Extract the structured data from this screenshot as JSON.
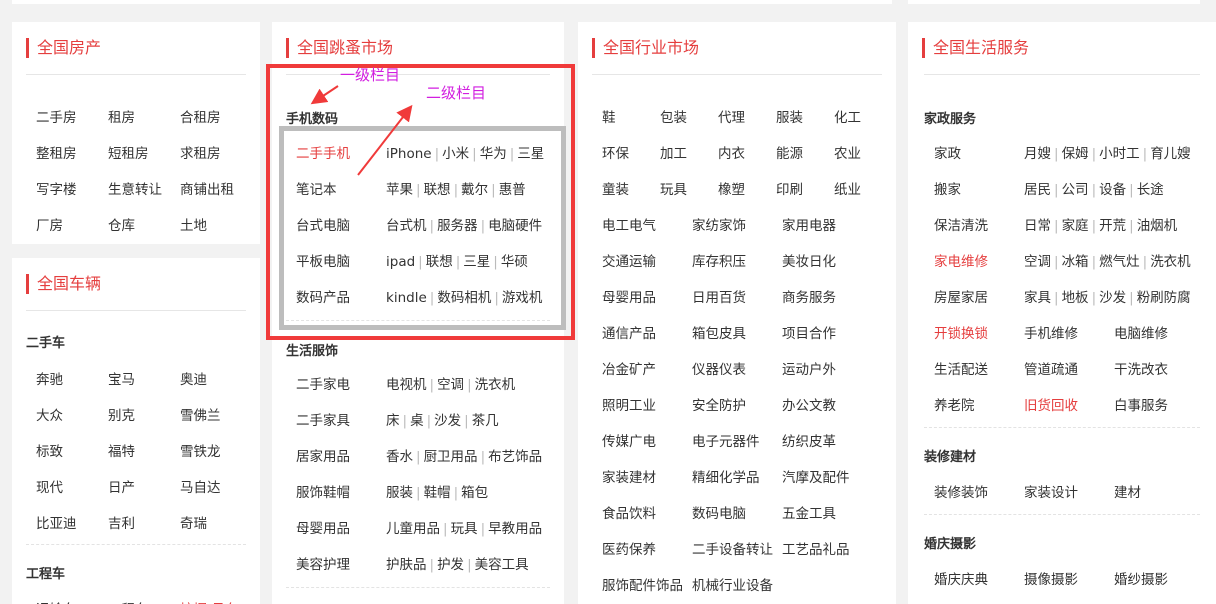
{
  "house": {
    "title": "全国房产",
    "grid": [
      "二手房",
      "租房",
      "合租房",
      "整租房",
      "短租房",
      "求租房",
      "写字楼",
      "生意转让",
      "商铺出租",
      "厂房",
      "仓库",
      "土地"
    ]
  },
  "car": {
    "title": "全国车辆",
    "sec1": "二手车",
    "sec1_grid": [
      "奔驰",
      "宝马",
      "奥迪",
      "大众",
      "别克",
      "雪佛兰",
      "标致",
      "福特",
      "雪铁龙",
      "现代",
      "日产",
      "马自达",
      "比亚迪",
      "吉利",
      "奇瑞"
    ],
    "sec2": "工程车",
    "sec2_grid": [
      "运输车",
      "工程车",
      "挖掘/吊车"
    ]
  },
  "flea": {
    "title": "全国跳蚤市场",
    "sec1": "手机数码",
    "rows1": [
      {
        "cat": "二手手机",
        "subs": [
          "iPhone",
          "小米",
          "华为",
          "三星"
        ]
      },
      {
        "cat": "笔记本",
        "subs": [
          "苹果",
          "联想",
          "戴尔",
          "惠普"
        ]
      },
      {
        "cat": "台式电脑",
        "subs": [
          "台式机",
          "服务器",
          "电脑硬件"
        ]
      },
      {
        "cat": "平板电脑",
        "subs": [
          "ipad",
          "联想",
          "三星",
          "华硕"
        ]
      },
      {
        "cat": "数码产品",
        "subs": [
          "kindle",
          "数码相机",
          "游戏机"
        ]
      }
    ],
    "sec2": "生活服饰",
    "rows2": [
      {
        "cat": "二手家电",
        "subs": [
          "电视机",
          "空调",
          "洗衣机"
        ]
      },
      {
        "cat": "二手家具",
        "subs": [
          "床",
          "桌",
          "沙发",
          "茶几"
        ]
      },
      {
        "cat": "居家用品",
        "subs": [
          "香水",
          "厨卫用品",
          "布艺饰品"
        ]
      },
      {
        "cat": "服饰鞋帽",
        "subs": [
          "服装",
          "鞋帽",
          "箱包"
        ]
      },
      {
        "cat": "母婴用品",
        "subs": [
          "儿童用品",
          "玩具",
          "早教用品"
        ]
      },
      {
        "cat": "美容护理",
        "subs": [
          "护肤品",
          "护发",
          "美容工具"
        ]
      }
    ],
    "anno1": "一级栏目",
    "anno2": "二级栏目"
  },
  "industry": {
    "title": "全国行业市场",
    "row5": [
      [
        "鞋",
        "包装",
        "代理",
        "服装",
        "化工"
      ],
      [
        "环保",
        "加工",
        "内衣",
        "能源",
        "农业"
      ],
      [
        "童装",
        "玩具",
        "橡塑",
        "印刷",
        "纸业"
      ]
    ],
    "row3": [
      [
        "电工电气",
        "家纺家饰",
        "家用电器"
      ],
      [
        "交通运输",
        "库存积压",
        "美妆日化"
      ],
      [
        "母婴用品",
        "日用百货",
        "商务服务"
      ],
      [
        "通信产品",
        "箱包皮具",
        "项目合作"
      ],
      [
        "冶金矿产",
        "仪器仪表",
        "运动户外"
      ],
      [
        "照明工业",
        "安全防护",
        "办公文教"
      ],
      [
        "传媒广电",
        "电子元器件",
        "纺织皮革"
      ],
      [
        "家装建材",
        "精细化学品",
        "汽摩及配件"
      ],
      [
        "食品饮料",
        "数码电脑",
        "五金工具"
      ],
      [
        "医药保养",
        "二手设备转让",
        "工艺品礼品"
      ],
      [
        "服饰配件饰品",
        "机械行业设备",
        ""
      ]
    ]
  },
  "life": {
    "title": "全国生活服务",
    "sec1": "家政服务",
    "rows1": [
      {
        "c1": "家政",
        "c2": [
          "月嫂",
          "保姆",
          "小时工",
          "育儿嫂"
        ]
      },
      {
        "c1": "搬家",
        "c2": [
          "居民",
          "公司",
          "设备",
          "长途"
        ]
      },
      {
        "c1": "保洁清洗",
        "c2": [
          "日常",
          "家庭",
          "开荒",
          "油烟机"
        ]
      },
      {
        "c1": "家电维修",
        "c2": [
          "空调",
          "冰箱",
          "燃气灶",
          "洗衣机"
        ]
      },
      {
        "c1": "房屋家居",
        "c2": [
          "家具",
          "地板",
          "沙发",
          "粉刷防腐"
        ]
      },
      {
        "c1": "开锁换锁",
        "c2": [
          "手机维修"
        ],
        "c3": "电脑维修"
      },
      {
        "c1": "生活配送",
        "c2": [
          "管道疏通"
        ],
        "c3": "干洗改衣"
      },
      {
        "c1": "养老院",
        "c2": [
          "旧货回收"
        ],
        "c3": "白事服务"
      }
    ],
    "sec2": "装修建材",
    "row2": [
      "装修装饰",
      "家装设计",
      "建材"
    ],
    "sec3": "婚庆摄影",
    "row3": [
      "婚庆庆典",
      "摄像摄影",
      "婚纱摄影"
    ],
    "accent": "#e53e3e"
  }
}
